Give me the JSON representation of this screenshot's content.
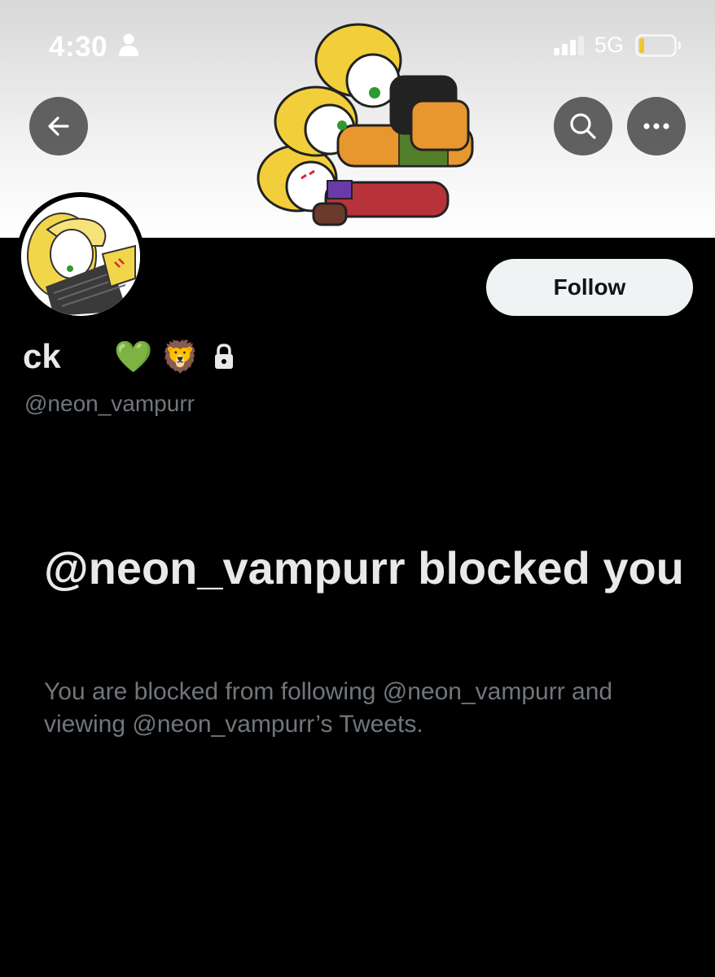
{
  "status_bar": {
    "time": "4:30",
    "network": "5G",
    "icons": [
      "person-icon",
      "signal-icon",
      "battery-icon"
    ]
  },
  "header": {
    "back_icon": "arrow-left-icon",
    "search_icon": "search-icon",
    "more_icon": "more-horizontal-icon"
  },
  "profile": {
    "display_name": "ck",
    "emojis": [
      "🐱",
      "💚",
      "🦁"
    ],
    "handle": "@neon_vampurr",
    "follow_label": "Follow",
    "protected_icon": "lock-icon"
  },
  "blocked": {
    "title": "@neon_vampurr blocked you",
    "description": "You are blocked from following @neon_vampurr and viewing @neon_vampurr’s Tweets."
  },
  "colors": {
    "background": "#000000",
    "primary_text": "#e7e9ea",
    "secondary_text": "#71767b",
    "follow_button_bg": "#eff3f4"
  }
}
